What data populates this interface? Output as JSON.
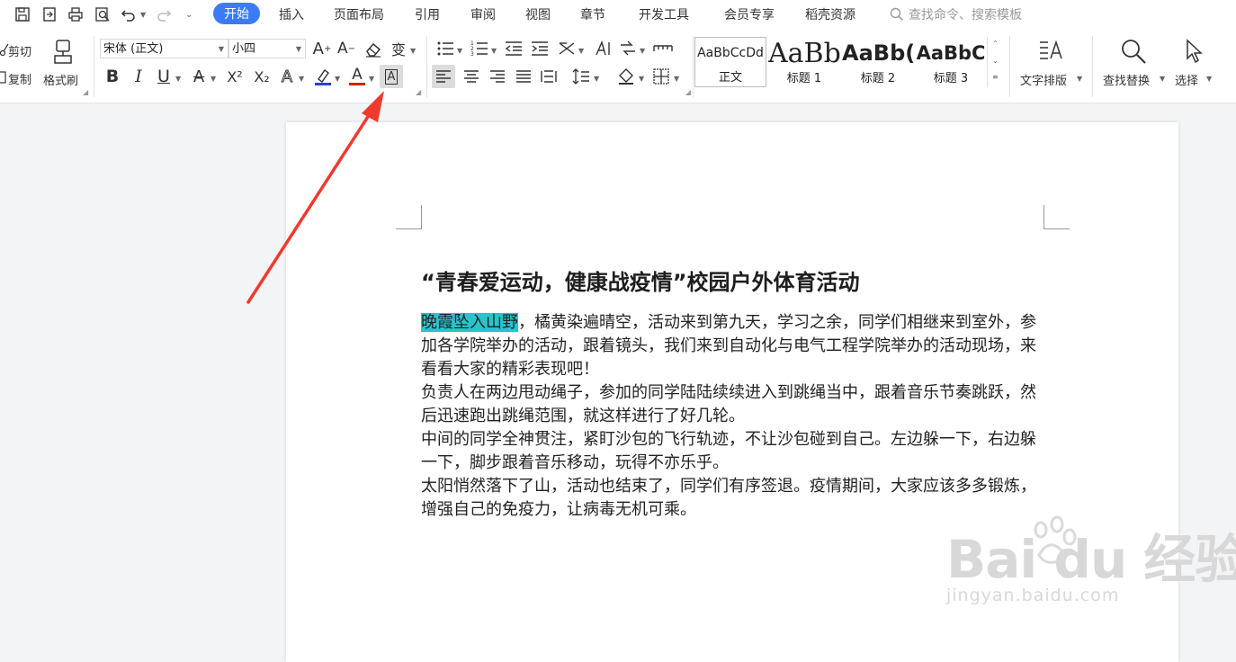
{
  "tabs": [
    {
      "label": "开始",
      "active": true
    },
    {
      "label": "插入"
    },
    {
      "label": "页面布局"
    },
    {
      "label": "引用"
    },
    {
      "label": "审阅"
    },
    {
      "label": "视图"
    },
    {
      "label": "章节"
    },
    {
      "label": "开发工具"
    },
    {
      "label": "会员专享"
    },
    {
      "label": "稻壳资源"
    }
  ],
  "search": {
    "placeholder": "查找命令、搜索模板"
  },
  "clipboard": {
    "cut": "剪切",
    "copy": "复制",
    "format_painter": "格式刷"
  },
  "font": {
    "name": "宋体 (正文)",
    "size": "小四"
  },
  "format": {
    "bold": "B",
    "italic": "I",
    "underline": "U",
    "superscript": "X²",
    "subscript": "X₂",
    "font_color_letter": "A",
    "char_border_letter": "A"
  },
  "styles": [
    {
      "sample": "AaBbCcDd",
      "name": "正文"
    },
    {
      "sample": "AaBb",
      "name": "标题 1"
    },
    {
      "sample": "AaBb(",
      "name": "标题 2"
    },
    {
      "sample": "AaBbC",
      "name": "标题 3"
    }
  ],
  "right_tools": {
    "text_layout": "文字排版",
    "find_replace": "查找替换",
    "select": "选择"
  },
  "colors": {
    "accent": "#3b7cf5",
    "highlight": "#27c4cc",
    "arrow": "#f03a2e"
  },
  "document": {
    "title": "“青春爱运动，健康战疫情”校园户外体育活动",
    "highlighted": "晚霞坠入山野",
    "p1_rest": "，橘黄染遍晴空，活动来到第九天，学习之余，同学们相继来到室外，参加各学院举办的活动，跟着镜头，我们来到自动化与电气工程学院举办的活动现场，来看看大家的精彩表现吧！",
    "p2": "负责人在两边甩动绳子，参加的同学陆陆续续进入到跳绳当中，跟着音乐节奏跳跃，然后迅速跑出跳绳范围，就这样进行了好几轮。",
    "p3": "中间的同学全神贯注，紧盯沙包的飞行轨迹，不让沙包碰到自己。左边躲一下，右边躲一下，脚步跟着音乐移动，玩得不亦乐乎。",
    "p4": "太阳悄然落下了山，活动也结束了，同学们有序签退。疫情期间，大家应该多多锻炼，增强自己的免疫力，让病毒无机可乘。"
  },
  "watermark": {
    "main": "Bai du 经验",
    "sub": "jingyan.baidu.com"
  }
}
